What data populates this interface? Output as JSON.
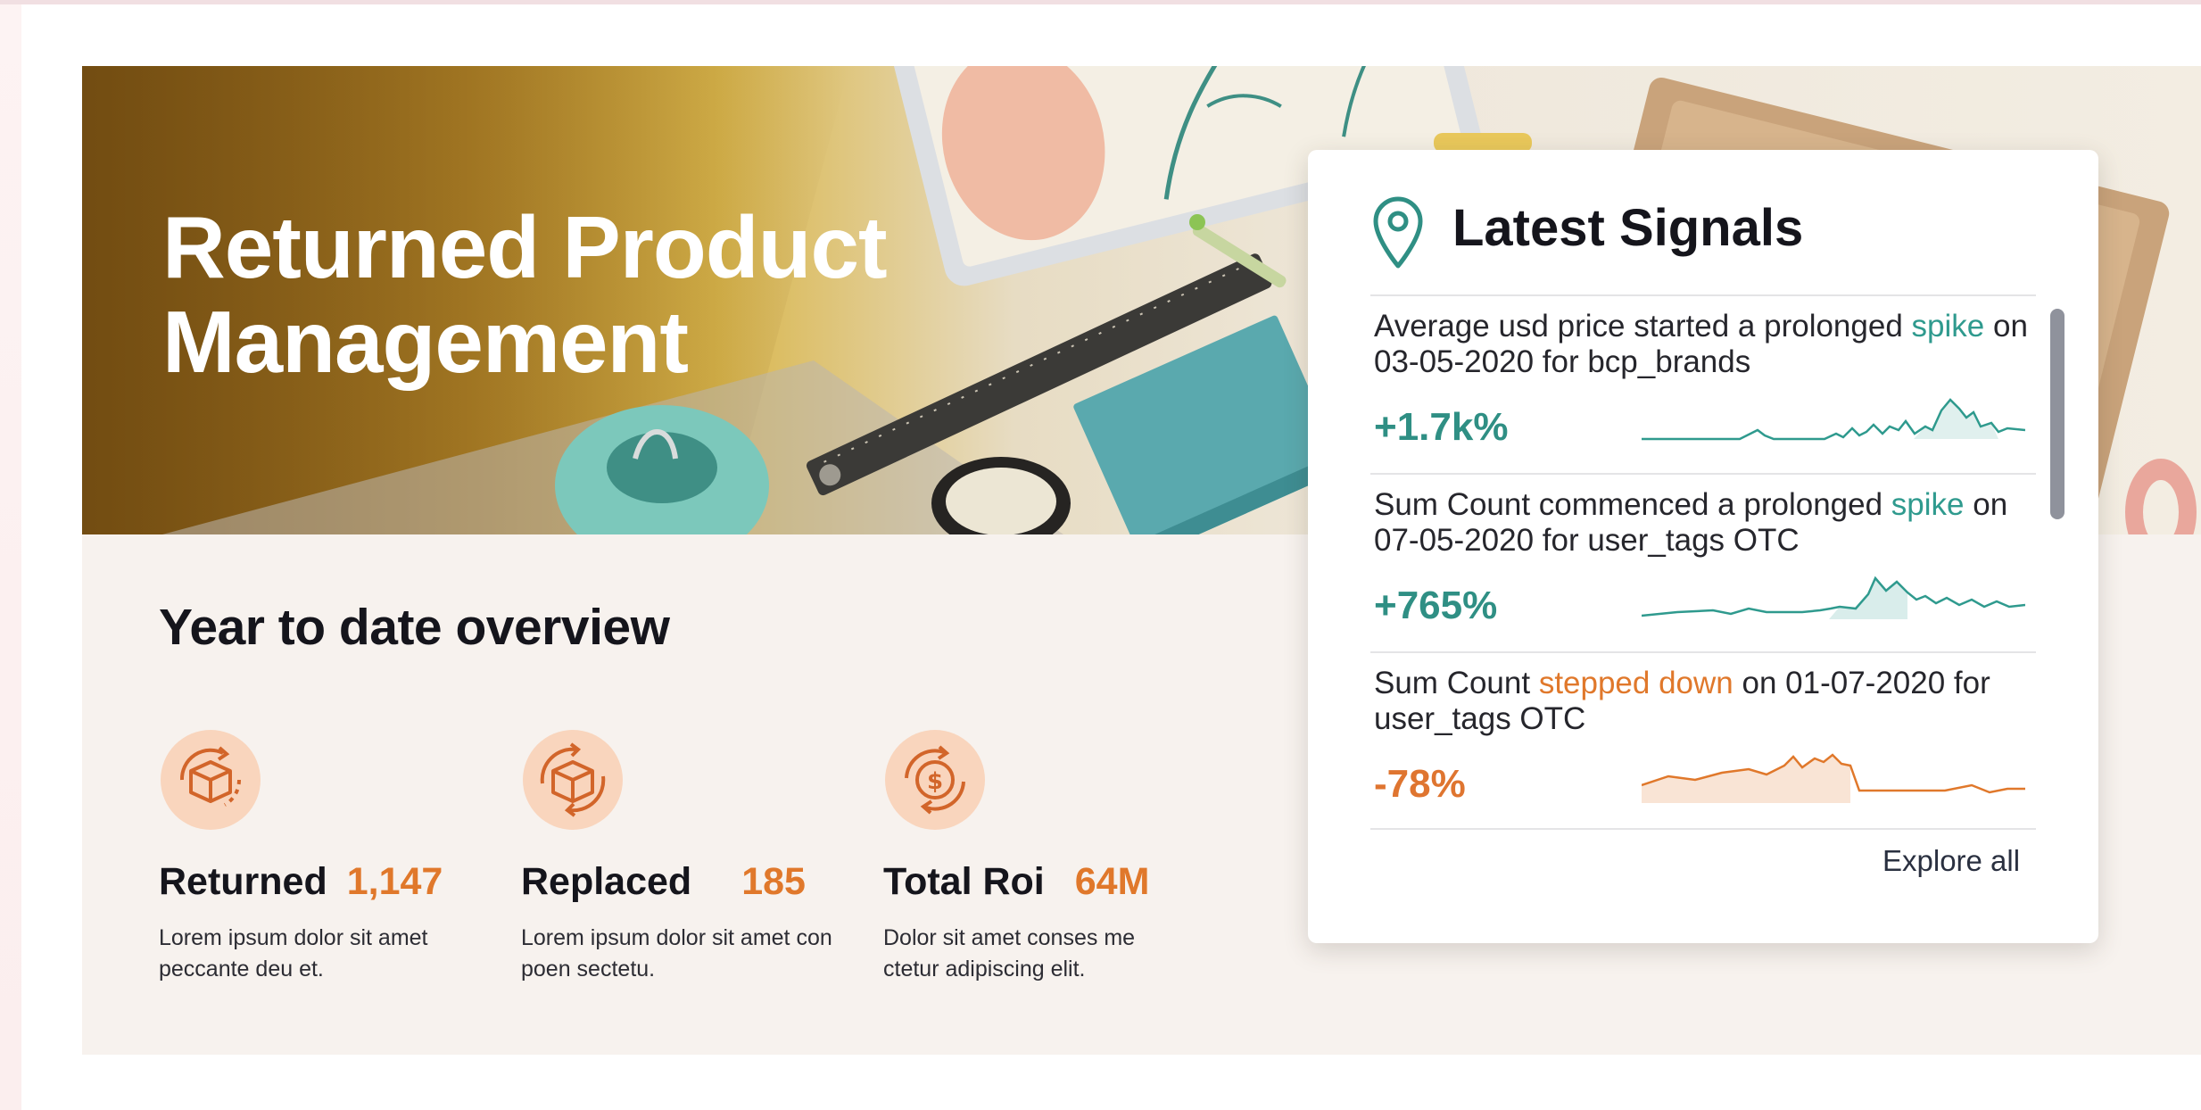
{
  "hero": {
    "title": "Returned Product Management"
  },
  "overview": {
    "title": "Year to date overview",
    "metrics": [
      {
        "icon": "box-return-icon",
        "label": "Returned",
        "value": "1,147",
        "description": "Lorem ipsum dolor sit amet peccante deu et."
      },
      {
        "icon": "box-replace-icon",
        "label": "Replaced",
        "value": "185",
        "description": "Lorem ipsum dolor sit amet con poen sectetu."
      },
      {
        "icon": "dollar-cycle-icon",
        "label": "Total Roi",
        "value": "64M",
        "description": "Dolor sit amet conses me ctetur adipiscing elit."
      }
    ]
  },
  "signals": {
    "title": "Latest Signals",
    "items": [
      {
        "text_before": "Average usd price started a prolonged ",
        "highlight": "spike",
        "text_after": " on 03-05-2020 for bcp_brands",
        "change": "+1.7k%",
        "trend": "up"
      },
      {
        "text_before": "Sum Count commenced a prolonged ",
        "highlight": "spike",
        "text_after": " on 07-05-2020 for user_tags OTC",
        "change": "+765%",
        "trend": "up"
      },
      {
        "text_before": "Sum Count ",
        "highlight": "stepped down",
        "text_after": " on 01-07-2020 for user_tags OTC",
        "change": "-78%",
        "trend": "down"
      }
    ],
    "explore_label": "Explore all"
  },
  "colors": {
    "accent_orange": "#e0782b",
    "accent_teal": "#2f9a8e",
    "icon_bg": "#f9d5bd",
    "card_bg": "#f7f2ee"
  }
}
